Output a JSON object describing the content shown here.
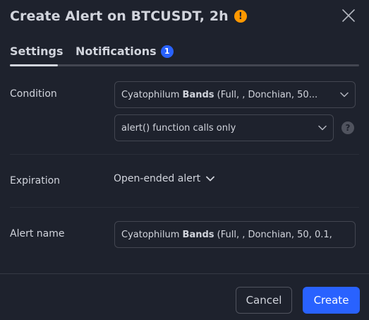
{
  "header": {
    "title": "Create Alert on BTCUSDT, 2h",
    "warning_glyph": "!",
    "warning_icon": "exclamation-circle-icon",
    "close_icon": "close-icon"
  },
  "tabs": [
    {
      "label": "Settings",
      "active": true
    },
    {
      "label": "Notifications",
      "badge": "1"
    }
  ],
  "condition": {
    "label": "Condition",
    "indicator_prefix": "Cyatophilum ",
    "indicator_bold": "Bands",
    "indicator_suffix": " (Full, , Donchian, 50...",
    "trigger": "alert() function calls only",
    "help_glyph": "?",
    "help_icon": "question-circle-icon"
  },
  "expiration": {
    "label": "Expiration",
    "value": "Open-ended alert"
  },
  "alert_name": {
    "label": "Alert name",
    "value_prefix": "Cyatophilum ",
    "value_bold": "Bands",
    "value_suffix": " (Full, , Donchian, 50, 0.1,"
  },
  "footer": {
    "cancel_label": "Cancel",
    "create_label": "Create"
  },
  "colors": {
    "background": "#1e222d",
    "accent": "#2962ff",
    "warning": "#ff9800",
    "text": "#d1d4dc",
    "border": "#434651"
  }
}
